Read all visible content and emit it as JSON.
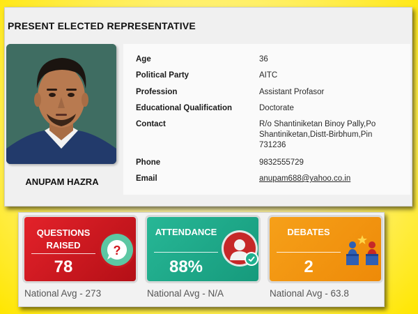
{
  "profile": {
    "section_title": "PRESENT ELECTED REPRESENTATIVE",
    "name": "ANUPAM HAZRA",
    "details": [
      {
        "label": "Age",
        "value": "36"
      },
      {
        "label": "Political Party",
        "value": "AITC"
      },
      {
        "label": "Profession",
        "value": "Assistant Profasor"
      },
      {
        "label": "Educational Qualification",
        "value": "Doctorate"
      },
      {
        "label": "Contact",
        "value": "R/o Shantiniketan Binoy Pally,Po Shantiniketan,Distt-Birbhum,Pin 731236"
      },
      {
        "label": "Phone",
        "value": "9832555729"
      },
      {
        "label": "Email",
        "value": "anupam688@yahoo.co.in"
      }
    ]
  },
  "stats": [
    {
      "title": "QUESTIONS RAISED",
      "value": "78",
      "national_avg": "National Avg - 273",
      "color": "#d0161e",
      "icon": "question-icon"
    },
    {
      "title": "ATTENDANCE",
      "value": "88%",
      "national_avg": "National Avg - N/A",
      "color": "#1fae8e",
      "icon": "person-check-icon"
    },
    {
      "title": "DEBATES",
      "value": "2",
      "national_avg": "National Avg - 63.8",
      "color": "#f2940e",
      "icon": "debate-podium-icon"
    }
  ],
  "colors": {
    "background": "#fff38a",
    "photo_background": "#3d6b61"
  }
}
